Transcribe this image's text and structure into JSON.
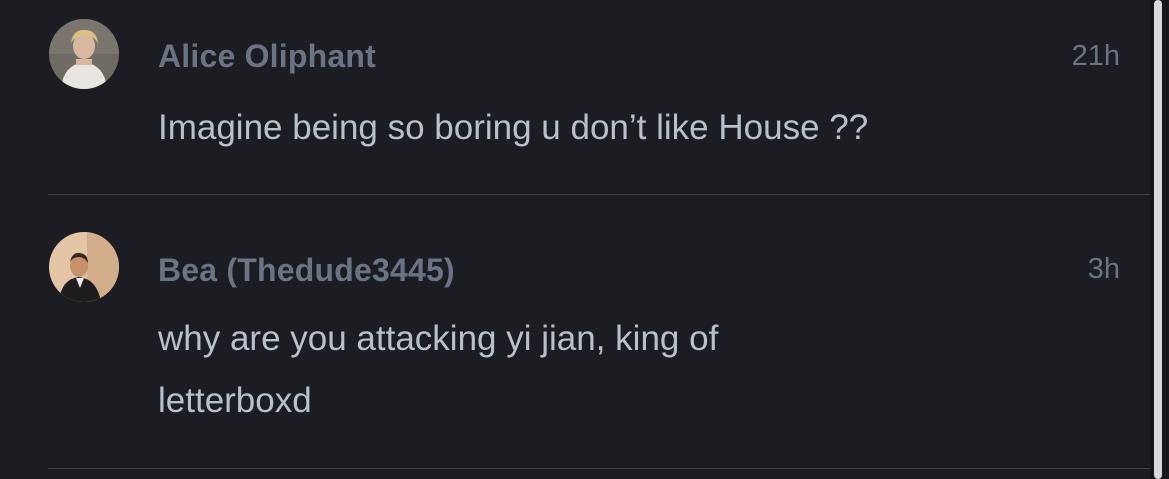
{
  "comments": [
    {
      "author": "Alice Oliphant",
      "time": "21h",
      "text": "Imagine being so boring u don’t like House ??",
      "avatar": "avatar-photo"
    },
    {
      "author": "Bea (Thedude3445)",
      "time": "3h",
      "text": "why are you attacking yi jian, king of letterboxd",
      "avatar": "avatar-photo"
    }
  ],
  "colors": {
    "background": "#1b1d22",
    "author": "#6a7484",
    "body_text": "#b7c0cc",
    "divider": "#3a404b",
    "scrollbar_thumb": "#d8d8d8"
  }
}
